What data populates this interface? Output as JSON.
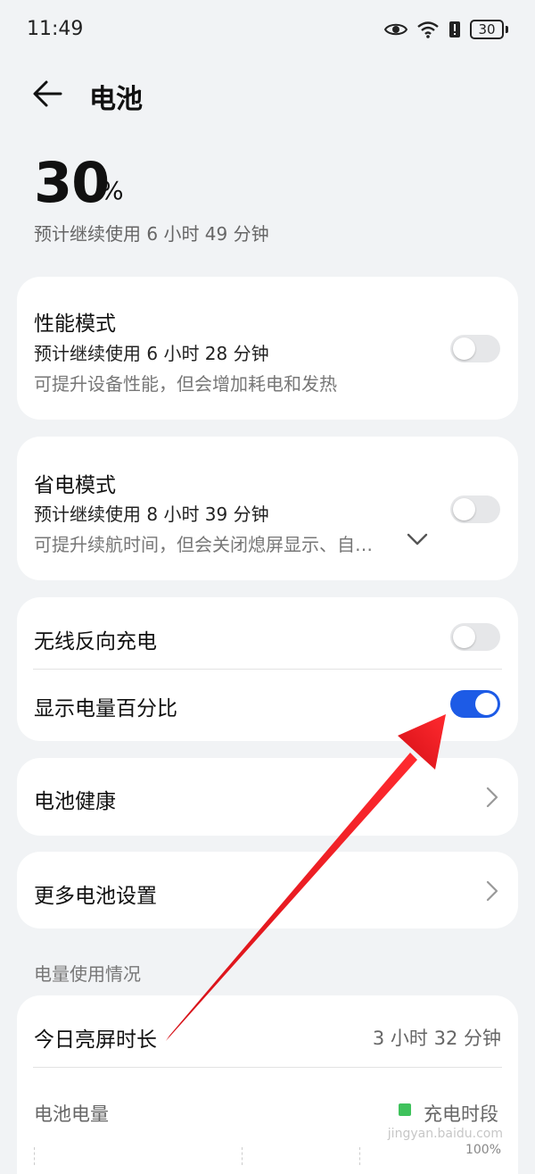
{
  "status_bar": {
    "time": "11:49",
    "battery_level": "30"
  },
  "header": {
    "title": "电池",
    "back_icon": "arrow-left-icon"
  },
  "battery": {
    "percent": "30",
    "unit": "%",
    "estimate": "预计继续使用 6 小时 49 分钟"
  },
  "performance_mode": {
    "title": "性能模式",
    "estimate": "预计继续使用 6 小时 28 分钟",
    "description": "可提升设备性能，但会增加耗电和发热",
    "enabled": false
  },
  "power_saving_mode": {
    "title": "省电模式",
    "estimate": "预计继续使用 8 小时 39 分钟",
    "description": "可提升续航时间，但会关闭熄屏显示、自…",
    "enabled": false
  },
  "wireless_reverse_charging": {
    "title": "无线反向充电",
    "enabled": false
  },
  "show_battery_percentage": {
    "title": "显示电量百分比",
    "enabled": true
  },
  "battery_health": {
    "title": "电池健康"
  },
  "more_battery_settings": {
    "title": "更多电池设置"
  },
  "usage": {
    "section_label": "电量使用情况",
    "screen_time_label": "今日亮屏时长",
    "screen_time_value": "3 小时 32 分钟",
    "battery_level_label": "电池电量",
    "legend_label": "充电时段",
    "axis_max": "100%"
  },
  "colors": {
    "accent": "#1d5be6",
    "charging_legend": "#3fc25c",
    "annotation_arrow": "#e8141b"
  }
}
